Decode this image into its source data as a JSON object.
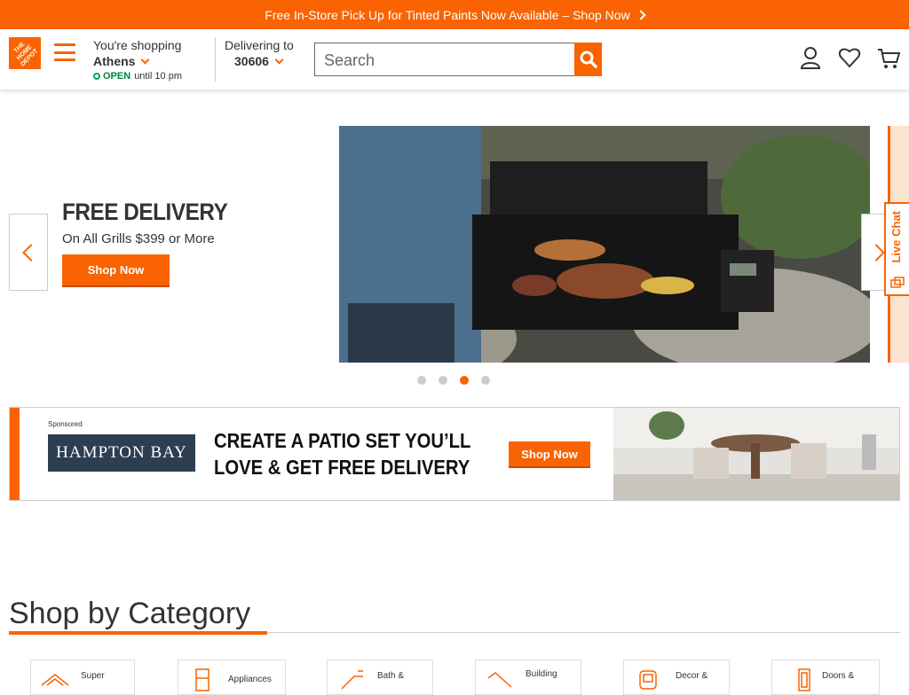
{
  "promo": {
    "text": "Free In-Store Pick Up for Tinted Paints Now Available – Shop Now"
  },
  "header": {
    "logo": "THE HOME DEPOT",
    "store_prefix": "You're shopping",
    "store_name": "Athens",
    "open_status": "OPEN",
    "open_hours": "until 10 pm",
    "delivering_label": "Delivering to",
    "zip": "30606",
    "search_placeholder": "Search"
  },
  "hero": {
    "headline": "FREE DELIVERY",
    "subline": "On All Grills $399 or More",
    "cta": "Shop Now",
    "dots": 4,
    "active_dot": 3
  },
  "live_chat": "Live Chat",
  "sponsored": {
    "label": "Sponsored",
    "brand": "HAMPTON BAY",
    "headline_line1": "CREATE A PATIO SET YOU’LL",
    "headline_line2": "LOVE & GET FREE DELIVERY",
    "cta": "Shop Now"
  },
  "categories": {
    "title": "Shop by Category",
    "items": [
      {
        "label": "Super",
        "icon": "house-icon"
      },
      {
        "label": "Appliances",
        "icon": "appliance-icon"
      },
      {
        "label": "Bath &",
        "icon": "faucet-icon"
      },
      {
        "label": "Building",
        "icon": "lumber-icon"
      },
      {
        "label": "Decor &",
        "icon": "chair-icon"
      },
      {
        "label": "Doors &",
        "icon": "door-icon"
      }
    ]
  },
  "colors": {
    "brand": "#f96302",
    "open": "#00853e"
  }
}
